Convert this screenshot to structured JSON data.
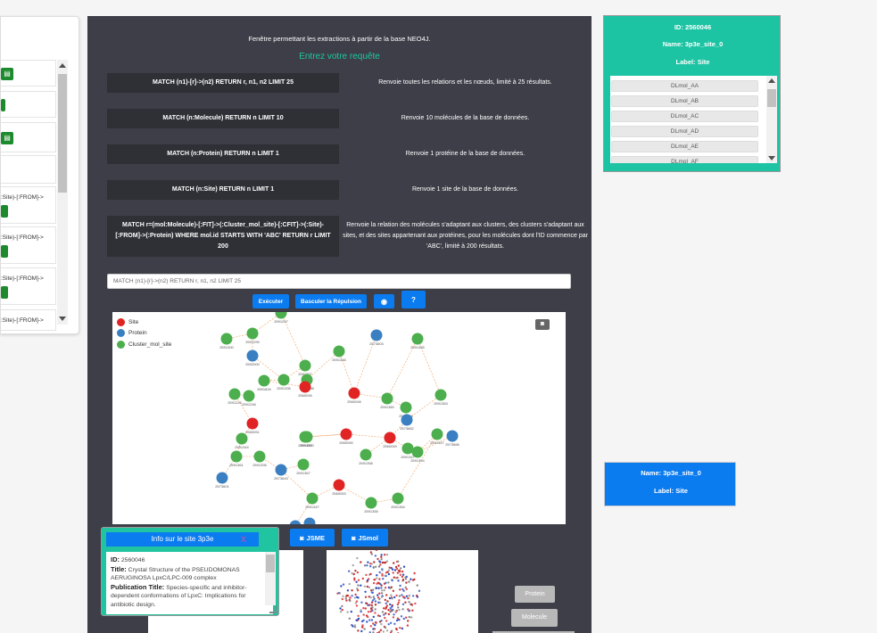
{
  "left_panel": {
    "rows": [
      {
        "text": ""
      },
      {
        "text": ""
      },
      {
        "text": ""
      },
      {
        "text": ""
      },
      {
        "text": ":Site)-[:FROM]->"
      },
      {
        "text": ":Site)-[:FROM]->"
      },
      {
        "text": ":Site)-[:FROM]->"
      },
      {
        "text": ":Site)-[:FROM]->"
      }
    ]
  },
  "center": {
    "title": "Fenêtre permettant les extractions à partir de la base NEO4J.",
    "subtitle": "Entrez votre requête",
    "queries": [
      {
        "query": "MATCH (n1)-[r]->(n2) RETURN r, n1, n2 LIMIT 25",
        "desc": "Renvoie toutes les relations et les nœuds, limité à 25 résultats."
      },
      {
        "query": "MATCH (n:Molecule) RETURN n LIMIT 10",
        "desc": "Renvoie 10 molécules de la base de données."
      },
      {
        "query": "MATCH (n:Protein) RETURN n LIMIT 1",
        "desc": "Renvoie 1 protéine de la base de données."
      },
      {
        "query": "MATCH (n:Site) RETURN n LIMIT 1",
        "desc": "Renvoie 1 site de la base de données."
      },
      {
        "query": "MATCH r=(mol:Molecule)-[:FIT]->(:Cluster_mol_site)-[:CFIT]->(:Site)-[:FROM]->(:Protein) WHERE mol.id STARTS WITH 'ABC' RETURN r LIMIT 200",
        "desc": "Renvoie la relation des molécules s'adaptant aux clusters, des clusters s'adaptant aux sites, et des sites appartenant aux protéines, pour les molécules dont l'ID commence par 'ABC', limité à 200 résultats."
      }
    ],
    "input_value": "MATCH (n1)-[r]->(n2) RETURN r, n1, n2 LIMIT 25",
    "buttons": {
      "execute": "Exécuter",
      "toggle": "Basculer la Répulsion",
      "eye": "◉",
      "help": "?"
    },
    "legend": [
      {
        "label": "Site",
        "color": "#e02424"
      },
      {
        "label": "Protein",
        "color": "#3a7fc1"
      },
      {
        "label": "Cluster_mol_site",
        "color": "#4cae4c"
      }
    ],
    "camera_icon": "camera-icon",
    "jsme_label": "JSME",
    "jsmol_label": "JSmol",
    "protein_label": "Protein",
    "molecule_label": "Molecule"
  },
  "info_popup": {
    "header": "Info sur le site 3p3e",
    "close": "X",
    "id_label": "ID:",
    "id_value": "2560046",
    "title_label": "Title:",
    "title_value": "Crystal Structure of the PSEUDOMONAS AERUGINOSA LpxC/LPC-009 complex",
    "pub_label": "Publication Title:",
    "pub_value": "Species-specific and inhibitor-dependent conformations of LpxC: Implications for antibiotic design."
  },
  "right_top": {
    "id_label": "ID:",
    "id_value": "2560046",
    "name_label": "Name:",
    "name_value": "3p3e_site_0",
    "label_label": "Label:",
    "label_value": "Site",
    "items": [
      "DLmol_AA",
      "DLmol_AB",
      "DLmol_AC",
      "DLmol_AD",
      "DLmol_AE",
      "DLmol_AF"
    ]
  },
  "right_bottom": {
    "name_label": "Name:",
    "name_value": "3p3e_site_0",
    "label_label": "Label:",
    "label_value": "Site"
  },
  "graph_nodes": [
    {
      "t": "c",
      "label": "2591257"
    },
    {
      "t": "c",
      "label": "2591300"
    },
    {
      "t": "c",
      "label": "2591299"
    },
    {
      "t": "p",
      "label": "2592000"
    },
    {
      "t": "c",
      "label": "2591207"
    },
    {
      "t": "c",
      "label": "2591816"
    },
    {
      "t": "c",
      "label": "2591335"
    },
    {
      "t": "p",
      "label": "2573603"
    },
    {
      "t": "c",
      "label": "2591465"
    },
    {
      "t": "c",
      "label": "2591346"
    },
    {
      "t": "c",
      "label": "2591538"
    },
    {
      "t": "s",
      "label": "2560045"
    },
    {
      "t": "c",
      "label": "2591226"
    },
    {
      "t": "c",
      "label": "2591246"
    },
    {
      "t": "s",
      "label": "2560046"
    },
    {
      "t": "c",
      "label": "2591360"
    },
    {
      "t": "c",
      "label": "2591334"
    },
    {
      "t": "c",
      "label": "2591363"
    },
    {
      "t": "c",
      "label": "2591350"
    },
    {
      "t": "p",
      "label": "2573662"
    },
    {
      "t": "s",
      "label": "2560051"
    },
    {
      "t": "c",
      "label": "2591344"
    },
    {
      "t": "c",
      "label": "2591367"
    },
    {
      "t": "s",
      "label": "2560050"
    },
    {
      "t": "s",
      "label": "2560049"
    },
    {
      "t": "c",
      "label": "2591347"
    },
    {
      "t": "c",
      "label": "2591354"
    },
    {
      "t": "p",
      "label": "2573666"
    },
    {
      "t": "c",
      "label": "2591361"
    },
    {
      "t": "c",
      "label": "2591335"
    },
    {
      "t": "c",
      "label": "2591358"
    },
    {
      "t": "c",
      "label": "2591367"
    },
    {
      "t": "c",
      "label": "2591347"
    },
    {
      "t": "p",
      "label": "2573601"
    },
    {
      "t": "p",
      "label": "2573643"
    },
    {
      "t": "c",
      "label": "2591347"
    },
    {
      "t": "s",
      "label": "2560053"
    },
    {
      "t": "c",
      "label": "2591355"
    },
    {
      "t": "c",
      "label": "2591354"
    },
    {
      "t": "p",
      "label": "2573646"
    },
    {
      "t": "p",
      "label": ""
    },
    {
      "t": "s",
      "label": ""
    }
  ]
}
